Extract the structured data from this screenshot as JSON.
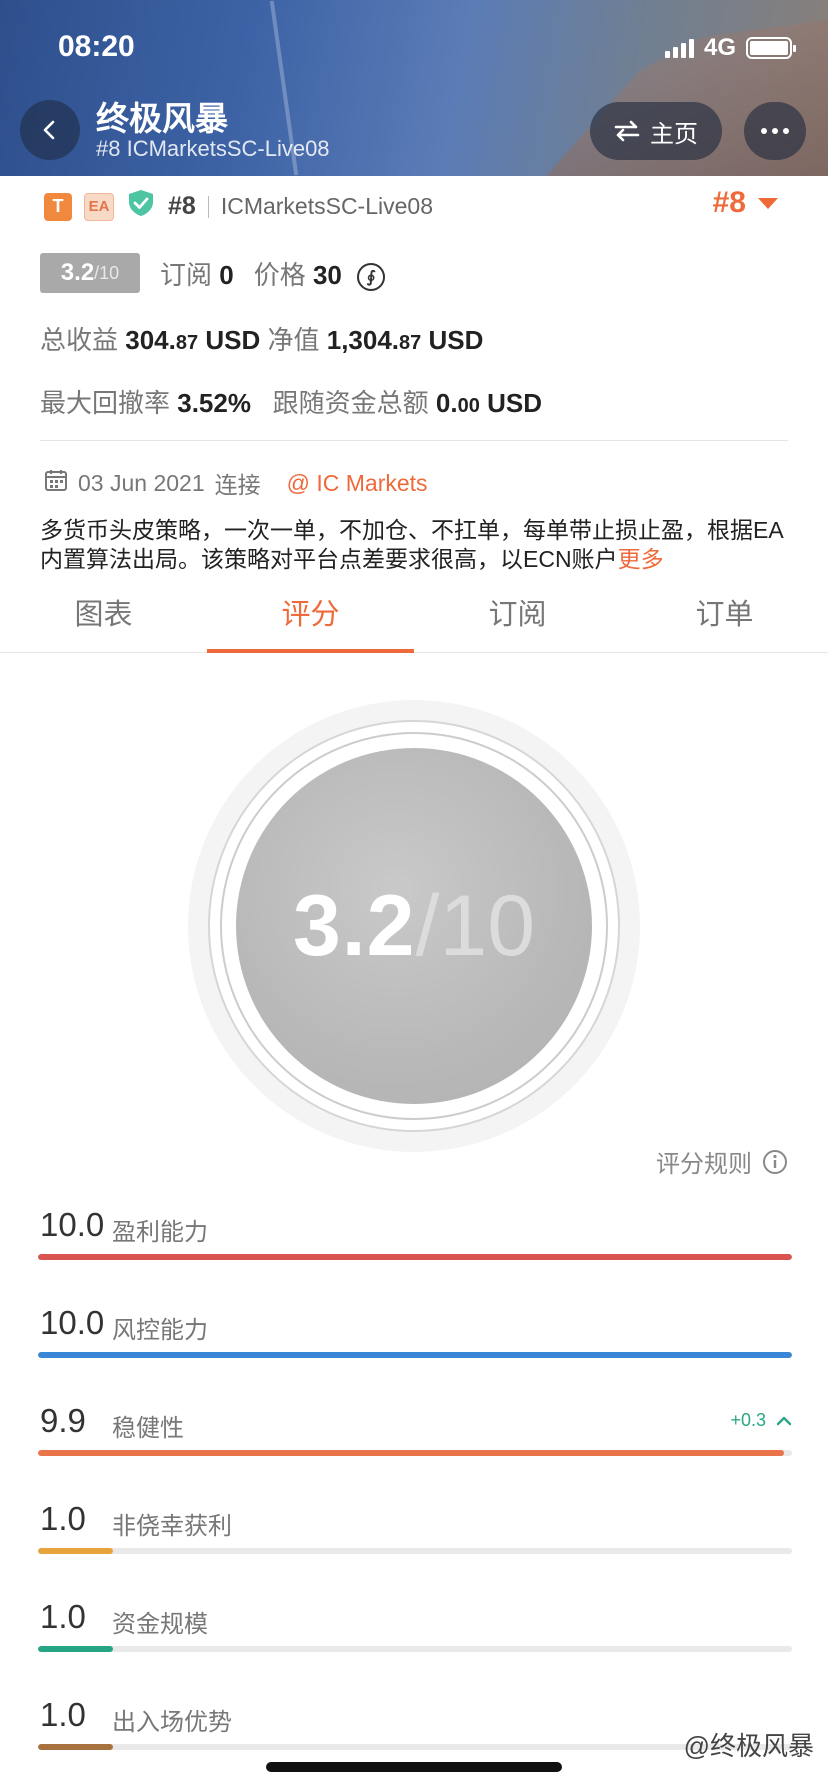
{
  "status_bar": {
    "time": "08:20",
    "network": "4G"
  },
  "header": {
    "title": "终极风暴",
    "subtitle": "#8 ICMarketsSC-Live08",
    "home_label": "主页"
  },
  "badges": {
    "t": "T",
    "ea": "EA"
  },
  "account": {
    "rank": "#8",
    "server": "ICMarketsSC-Live08",
    "rank_right": "#8"
  },
  "stats": {
    "score": "3.2",
    "score_denom": "/10",
    "subscribe_label": "订阅",
    "subscribe_value": "0",
    "price_label": "价格",
    "price_value": "30",
    "coin_symbol": "∮",
    "total_profit_label": "总收益",
    "total_profit_int": "304.",
    "total_profit_dec": "87",
    "total_profit_unit": "USD",
    "equity_label": "净值",
    "equity_int": "1,304.",
    "equity_dec": "87",
    "equity_unit": "USD",
    "max_drawdown_label": "最大回撤率",
    "max_drawdown_value": "3.52%",
    "follow_funds_label": "跟随资金总额",
    "follow_funds_int": "0.",
    "follow_funds_dec": "00",
    "follow_funds_unit": "USD"
  },
  "connect": {
    "date": "03 Jun 2021",
    "connect_label": "连接",
    "broker": "@ IC Markets"
  },
  "description": {
    "text": "多货币头皮策略，一次一单，不加仓、不扛单，每单带止损止盈，根据EA内置算法出局。该策略对平台点差要求很高，以ECN账户",
    "more_label": "更多"
  },
  "tabs": [
    {
      "label": "图表"
    },
    {
      "label": "评分"
    },
    {
      "label": "订阅"
    },
    {
      "label": "订单"
    }
  ],
  "score_circle": {
    "score": "3.2",
    "denom": "/10"
  },
  "rules_label": "评分规则",
  "metrics": [
    {
      "value": "10.0",
      "label": "盈利能力",
      "fraction": 1.0,
      "color": "#d9534f",
      "change": ""
    },
    {
      "value": "10.0",
      "label": "风控能力",
      "fraction": 1.0,
      "color": "#3a86d6",
      "change": ""
    },
    {
      "value": "9.9",
      "label": "稳健性",
      "fraction": 0.99,
      "color": "#e97449",
      "change": "+0.3"
    },
    {
      "value": "1.0",
      "label": "非侥幸获利",
      "fraction": 0.1,
      "color": "#e8a43c",
      "change": ""
    },
    {
      "value": "1.0",
      "label": "资金规模",
      "fraction": 0.1,
      "color": "#26a585",
      "change": ""
    },
    {
      "value": "1.0",
      "label": "出入场优势",
      "fraction": 0.1,
      "color": "#a8723e",
      "change": ""
    }
  ],
  "watermark": "@终极风暴",
  "colors": {
    "accent": "#ee6a3a",
    "positive": "#2aa786"
  }
}
